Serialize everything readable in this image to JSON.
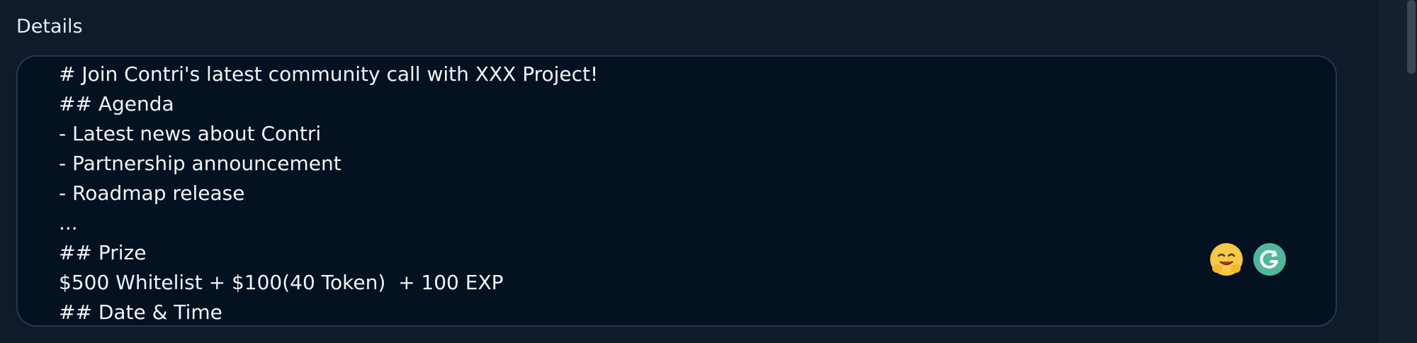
{
  "field": {
    "label": "Details"
  },
  "editor": {
    "lines": [
      "# Join Contri's latest community call with XXX Project!",
      "## Agenda",
      "- Latest news about Contri",
      "- Partnership announcement",
      "- Roadmap release",
      "...",
      "## Prize",
      "$500 Whitelist + $100(40 Token)  + 100 EXP",
      "## Date & Time"
    ]
  },
  "extensions": {
    "emoji_icon": "hugging-face-emoji-icon",
    "grammarly_icon": "grammarly-icon"
  },
  "colors": {
    "background": "#0f1b2b",
    "editor_background": "#031120",
    "editor_border": "#26384d",
    "text": "#f2f4f7",
    "grammarly": "#4fb89a"
  }
}
